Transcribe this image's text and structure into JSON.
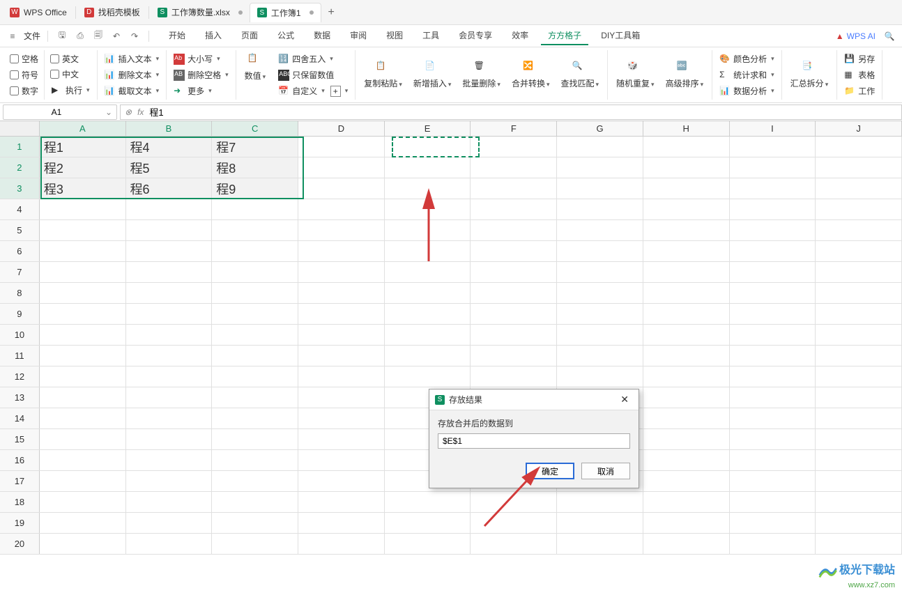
{
  "titlebar": {
    "app_name": "WPS Office",
    "tabs": [
      {
        "icon": "D",
        "icon_color": "#d23a3a",
        "label": "找稻壳模板"
      },
      {
        "icon": "S",
        "icon_color": "#0f8f60",
        "label": "工作簿数量.xlsx",
        "has_dot": true
      },
      {
        "icon": "S",
        "icon_color": "#0f8f60",
        "label": "工作簿1",
        "active": true,
        "has_dot": true
      }
    ],
    "add_label": "+"
  },
  "menubar": {
    "file_label": "文件",
    "items": [
      "开始",
      "插入",
      "页面",
      "公式",
      "数据",
      "审阅",
      "视图",
      "工具",
      "会员专享",
      "效率",
      "方方格子",
      "DIY工具箱"
    ],
    "active_index": 10,
    "wps_ai": "WPS AI"
  },
  "ribbon": {
    "checks_col1": [
      "空格",
      "符号",
      "数字"
    ],
    "checks_col2": [
      "英文",
      "中文",
      "执行"
    ],
    "text_group": [
      "插入文本",
      "删除文本",
      "截取文本"
    ],
    "case_group": [
      "大小写",
      "删除空格",
      "更多"
    ],
    "numeric": {
      "label": "数值",
      "items": [
        "四舍五入",
        "只保留数值",
        "自定义"
      ]
    },
    "big_buttons": [
      "复制粘贴",
      "新增插入",
      "批量删除",
      "合并转换",
      "查找匹配",
      "随机重复",
      "高级排序"
    ],
    "analysis": [
      "颜色分析",
      "统计求和",
      "数据分析"
    ],
    "summary": "汇总拆分",
    "right_items": [
      "另存",
      "表格",
      "工作"
    ]
  },
  "formula_bar": {
    "name_box": "A1",
    "fx_value": "程1"
  },
  "sheet": {
    "columns": [
      "A",
      "B",
      "C",
      "D",
      "E",
      "F",
      "G",
      "H",
      "I",
      "J"
    ],
    "selected_cols": [
      0,
      1,
      2
    ],
    "rows": 20,
    "selected_rows": [
      1,
      2,
      3
    ],
    "data": {
      "1": {
        "A": "程1",
        "B": "程4",
        "C": "程7"
      },
      "2": {
        "A": "程2",
        "B": "程5",
        "C": "程8"
      },
      "3": {
        "A": "程3",
        "B": "程6",
        "C": "程9"
      }
    }
  },
  "dialog": {
    "title": "存放结果",
    "label": "存放合并后的数据到",
    "value": "$E$1",
    "ok": "确定",
    "cancel": "取消"
  },
  "watermark": {
    "title": "极光下载站",
    "url": "www.xz7.com"
  }
}
